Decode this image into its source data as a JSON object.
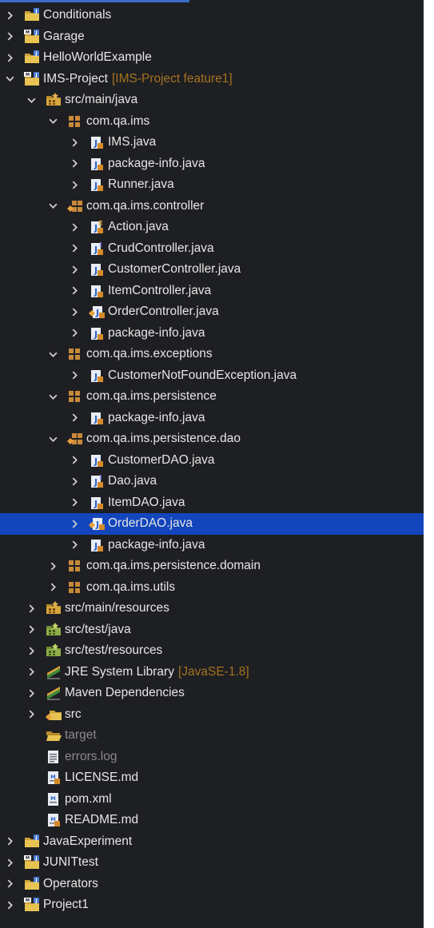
{
  "colors": {
    "background": "#1e1f22",
    "selection": "#1346bd",
    "text": "#e6e6e6",
    "dimText": "#8a8a8a",
    "decoration": "#a3731f"
  },
  "tree": [
    {
      "depth": 0,
      "state": "collapsed",
      "icon": "project-folder-icon",
      "label": "Conditionals"
    },
    {
      "depth": 0,
      "state": "collapsed",
      "icon": "maven-project-icon",
      "label": "Garage"
    },
    {
      "depth": 0,
      "state": "collapsed",
      "icon": "project-folder-icon",
      "label": "HelloWorldExample"
    },
    {
      "depth": 0,
      "state": "expanded",
      "icon": "maven-project-icon",
      "label": "IMS-Project",
      "extra": "[IMS-Project feature1]"
    },
    {
      "depth": 1,
      "state": "expanded",
      "icon": "source-folder-icon",
      "label": "src/main/java"
    },
    {
      "depth": 2,
      "state": "expanded",
      "icon": "package-icon",
      "label": "com.qa.ims"
    },
    {
      "depth": 3,
      "state": "collapsed",
      "icon": "java-file-icon",
      "label": "IMS.java"
    },
    {
      "depth": 3,
      "state": "collapsed",
      "icon": "java-file-icon",
      "label": "package-info.java"
    },
    {
      "depth": 3,
      "state": "collapsed",
      "icon": "java-file-icon",
      "label": "Runner.java"
    },
    {
      "depth": 2,
      "state": "expanded",
      "icon": "package-modified-icon",
      "label": "com.qa.ims.controller"
    },
    {
      "depth": 3,
      "state": "collapsed",
      "icon": "enum-file-icon",
      "label": "Action.java"
    },
    {
      "depth": 3,
      "state": "collapsed",
      "icon": "interface-file-icon",
      "label": "CrudController.java"
    },
    {
      "depth": 3,
      "state": "collapsed",
      "icon": "java-file-icon",
      "label": "CustomerController.java"
    },
    {
      "depth": 3,
      "state": "collapsed",
      "icon": "java-file-icon",
      "label": "ItemController.java"
    },
    {
      "depth": 3,
      "state": "collapsed",
      "icon": "java-file-modified-icon",
      "label": "OrderController.java"
    },
    {
      "depth": 3,
      "state": "collapsed",
      "icon": "java-file-icon",
      "label": "package-info.java"
    },
    {
      "depth": 2,
      "state": "expanded",
      "icon": "package-icon",
      "label": "com.qa.ims.exceptions"
    },
    {
      "depth": 3,
      "state": "collapsed",
      "icon": "java-file-icon",
      "label": "CustomerNotFoundException.java"
    },
    {
      "depth": 2,
      "state": "expanded",
      "icon": "package-icon",
      "label": "com.qa.ims.persistence"
    },
    {
      "depth": 3,
      "state": "collapsed",
      "icon": "java-file-icon",
      "label": "package-info.java"
    },
    {
      "depth": 2,
      "state": "expanded",
      "icon": "package-modified-icon",
      "label": "com.qa.ims.persistence.dao"
    },
    {
      "depth": 3,
      "state": "collapsed",
      "icon": "java-file-icon",
      "label": "CustomerDAO.java"
    },
    {
      "depth": 3,
      "state": "collapsed",
      "icon": "interface-file-icon",
      "label": "Dao.java"
    },
    {
      "depth": 3,
      "state": "collapsed",
      "icon": "java-file-icon",
      "label": "ItemDAO.java"
    },
    {
      "depth": 3,
      "state": "collapsed",
      "icon": "java-file-modified-icon",
      "label": "OrderDAO.java",
      "selected": true
    },
    {
      "depth": 3,
      "state": "collapsed",
      "icon": "java-file-icon",
      "label": "package-info.java"
    },
    {
      "depth": 2,
      "state": "collapsed",
      "icon": "package-icon",
      "label": "com.qa.ims.persistence.domain"
    },
    {
      "depth": 2,
      "state": "collapsed",
      "icon": "package-icon",
      "label": "com.qa.ims.utils"
    },
    {
      "depth": 1,
      "state": "collapsed",
      "icon": "source-folder-icon",
      "label": "src/main/resources"
    },
    {
      "depth": 1,
      "state": "collapsed",
      "icon": "test-source-folder-icon",
      "label": "src/test/java"
    },
    {
      "depth": 1,
      "state": "collapsed",
      "icon": "test-source-folder-icon",
      "label": "src/test/resources"
    },
    {
      "depth": 1,
      "state": "collapsed",
      "icon": "library-icon",
      "label": "JRE System Library",
      "extra": "[JavaSE-1.8]"
    },
    {
      "depth": 1,
      "state": "collapsed",
      "icon": "library-icon",
      "label": "Maven Dependencies"
    },
    {
      "depth": 1,
      "state": "collapsed",
      "icon": "folder-modified-icon",
      "label": "src"
    },
    {
      "depth": 1,
      "state": "leaf",
      "icon": "open-folder-icon",
      "label": "target",
      "dim": true
    },
    {
      "depth": 1,
      "state": "leaf",
      "icon": "text-file-icon",
      "label": "errors.log",
      "dim": true
    },
    {
      "depth": 1,
      "state": "leaf",
      "icon": "markdown-file-icon",
      "label": "LICENSE.md"
    },
    {
      "depth": 1,
      "state": "leaf",
      "icon": "xml-file-icon",
      "label": "pom.xml"
    },
    {
      "depth": 1,
      "state": "leaf",
      "icon": "markdown-file-icon",
      "label": "README.md"
    },
    {
      "depth": 0,
      "state": "collapsed",
      "icon": "project-folder-icon",
      "label": "JavaExperiment"
    },
    {
      "depth": 0,
      "state": "collapsed",
      "icon": "maven-project-icon",
      "label": "JUNITtest"
    },
    {
      "depth": 0,
      "state": "collapsed",
      "icon": "project-folder-icon",
      "label": "Operators"
    },
    {
      "depth": 0,
      "state": "collapsed",
      "icon": "maven-project-icon",
      "label": "Project1"
    }
  ]
}
